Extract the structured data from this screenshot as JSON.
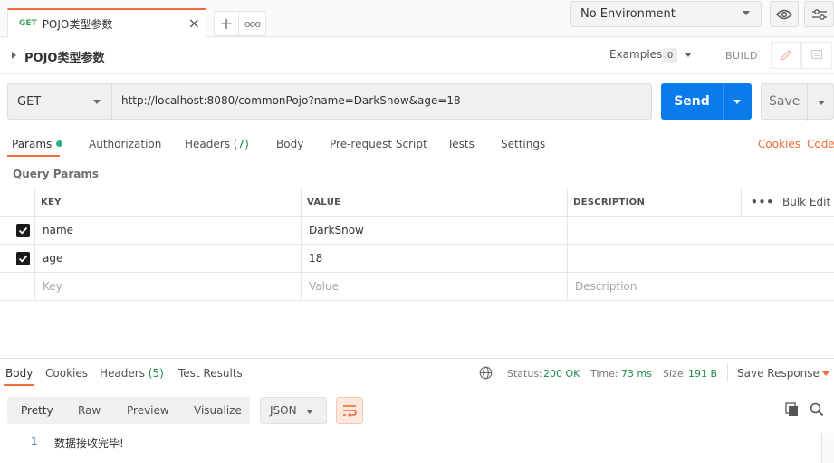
{
  "tab": {
    "method": "GET",
    "title": "POJO类型参数",
    "close": "×"
  },
  "toolbar": {
    "new_tab": "+",
    "more": "ooo"
  },
  "environment": {
    "selected": "No Environment"
  },
  "request": {
    "name": "POJO类型参数",
    "examples_label": "Examples",
    "examples_count": "0",
    "build_label": "BUILD",
    "method": "GET",
    "url": "http://localhost:8080/commonPojo?name=DarkSnow&age=18",
    "send_label": "Send",
    "save_label": "Save"
  },
  "request_tabs": {
    "params": "Params",
    "authorization": "Authorization",
    "headers": "Headers",
    "headers_count": "(7)",
    "body": "Body",
    "prerequest": "Pre-request Script",
    "tests": "Tests",
    "settings": "Settings",
    "cookies": "Cookies",
    "code": "Code"
  },
  "query_params": {
    "title": "Query Params",
    "columns": {
      "key": "KEY",
      "value": "VALUE",
      "description": "DESCRIPTION"
    },
    "more": "•••",
    "bulk_edit": "Bulk Edit",
    "rows": [
      {
        "key": "name",
        "value": "DarkSnow",
        "checked": true
      },
      {
        "key": "age",
        "value": "18",
        "checked": true
      }
    ],
    "placeholders": {
      "key": "Key",
      "value": "Value",
      "description": "Description"
    }
  },
  "response_tabs": {
    "body": "Body",
    "cookies": "Cookies",
    "headers": "Headers",
    "headers_count": "(5)",
    "test_results": "Test Results"
  },
  "response_status": {
    "status_label": "Status:",
    "status_value": "200 OK",
    "time_label": "Time:",
    "time_value": "73 ms",
    "size_label": "Size:",
    "size_value": "191 B",
    "save_response": "Save Response"
  },
  "response_view": {
    "modes": [
      "Pretty",
      "Raw",
      "Preview",
      "Visualize"
    ],
    "format": "JSON"
  },
  "response_body": {
    "line_number": "1",
    "line": "数据接收完毕!"
  },
  "colors": {
    "accent": "#f26b3a",
    "send": "#097bed",
    "success": "#1c8c46"
  }
}
